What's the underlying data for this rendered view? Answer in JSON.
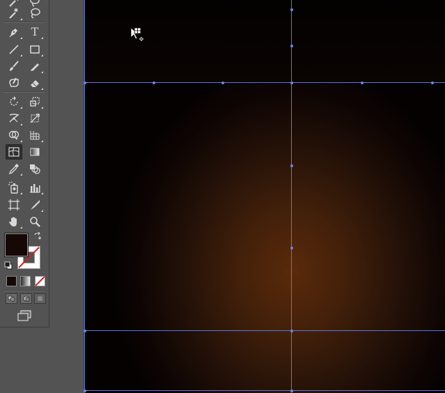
{
  "app": {
    "window_title": ""
  },
  "toolbar": {
    "tools": [
      {
        "name": "magic-wand-icon"
      },
      {
        "name": "lasso-icon"
      },
      {
        "name": "pen-icon"
      },
      {
        "name": "type-icon",
        "glyph": "T"
      },
      {
        "name": "line-segment-icon"
      },
      {
        "name": "rectangle-icon"
      },
      {
        "name": "paintbrush-icon"
      },
      {
        "name": "pencil-icon"
      },
      {
        "name": "blob-brush-icon"
      },
      {
        "name": "eraser-icon"
      },
      {
        "name": "rotate-icon"
      },
      {
        "name": "scale-icon"
      },
      {
        "name": "width-icon"
      },
      {
        "name": "free-transform-icon"
      },
      {
        "name": "shape-builder-icon"
      },
      {
        "name": "perspective-grid-icon"
      },
      {
        "name": "mesh-icon",
        "active": true
      },
      {
        "name": "gradient-icon"
      },
      {
        "name": "eyedropper-icon"
      },
      {
        "name": "blend-icon"
      },
      {
        "name": "symbol-sprayer-icon"
      },
      {
        "name": "column-graph-icon"
      },
      {
        "name": "artboard-icon"
      },
      {
        "name": "slice-icon"
      },
      {
        "name": "hand-icon"
      },
      {
        "name": "zoom-icon"
      }
    ],
    "fill_color": "#150806",
    "stroke_color": "none",
    "color_modes": [
      "color",
      "gradient",
      "none"
    ],
    "draw_modes": [
      "draw-normal",
      "draw-behind",
      "draw-inside"
    ],
    "screen_mode": "screen-mode-icon"
  },
  "canvas": {
    "background_center": "#5a2a0a",
    "background_edge": "#050101",
    "guide_color": "#5c78d6",
    "cursor": "mesh-cursor-icon"
  }
}
